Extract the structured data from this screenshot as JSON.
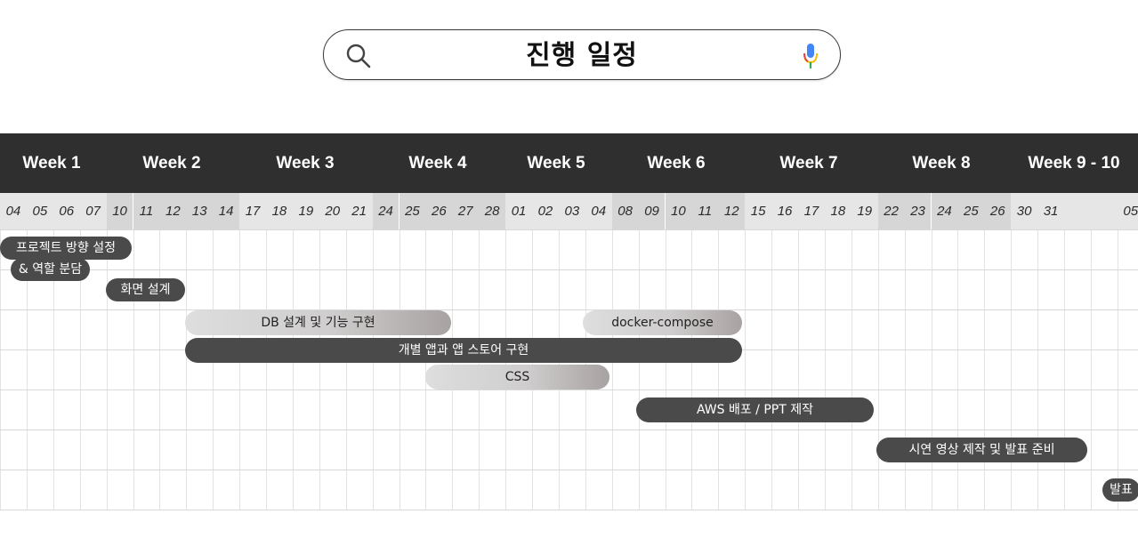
{
  "search": {
    "title": "진행 일정",
    "left_icon": "search-icon",
    "right_icon": "mic-icon"
  },
  "weeks": [
    {
      "label": "Week 1"
    },
    {
      "label": "Week 2"
    },
    {
      "label": "Week 3"
    },
    {
      "label": "Week 4"
    },
    {
      "label": "Week 5"
    },
    {
      "label": "Week 6"
    },
    {
      "label": "Week 7"
    },
    {
      "label": "Week 8"
    },
    {
      "label": "Week 9 - 10"
    }
  ],
  "days": [
    "04",
    "05",
    "06",
    "07",
    "10",
    "11",
    "12",
    "13",
    "14",
    "17",
    "18",
    "19",
    "20",
    "21",
    "24",
    "25",
    "26",
    "27",
    "28",
    "01",
    "02",
    "03",
    "04",
    "08",
    "09",
    "10",
    "11",
    "12",
    "15",
    "16",
    "17",
    "18",
    "19",
    "22",
    "23",
    "24",
    "25",
    "26",
    "30",
    "31",
    "",
    "",
    "05"
  ],
  "tasks": [
    {
      "label": "프로젝트 방향 설정",
      "style": "dark"
    },
    {
      "label": "& 역할 분담",
      "style": "dark"
    },
    {
      "label": "화면 설계",
      "style": "dark"
    },
    {
      "label": "DB 설계 및 기능 구현",
      "style": "light"
    },
    {
      "label": "docker-compose",
      "style": "light"
    },
    {
      "label": "개별 앱과 앱 스토어 구현",
      "style": "dark"
    },
    {
      "label": "CSS",
      "style": "light"
    },
    {
      "label": "AWS 배포 / PPT 제작",
      "style": "dark"
    },
    {
      "label": "시연 영상 제작 및 발표 준비",
      "style": "dark"
    },
    {
      "label": "발표",
      "style": "dark"
    }
  ],
  "colors": {
    "header": "#2f2f2f",
    "bar_dark": "#4a4a4a",
    "day_shade_a": "#e6e6e6",
    "day_shade_b": "#d6d6d6"
  }
}
